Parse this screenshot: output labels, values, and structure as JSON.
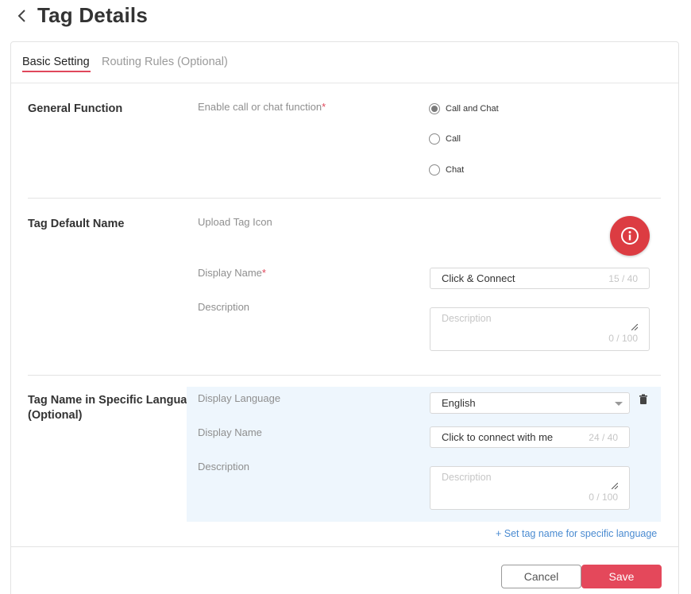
{
  "header": {
    "title": "Tag Details"
  },
  "tabs": [
    {
      "label": "Basic Setting",
      "active": true
    },
    {
      "label": "Routing Rules (Optional)",
      "active": false
    }
  ],
  "general": {
    "title": "General Function",
    "field_label": "Enable call or chat function",
    "required_mark": "*",
    "options": [
      {
        "label": "Call and Chat",
        "checked": true
      },
      {
        "label": "Call",
        "checked": false
      },
      {
        "label": "Chat",
        "checked": false
      }
    ]
  },
  "default_name": {
    "title": "Tag Default Name",
    "upload_label": "Upload Tag Icon",
    "icon_name": "info-icon",
    "display_name_label": "Display Name",
    "required_mark": "*",
    "display_name_value": "Click & Connect",
    "display_name_count": "15 / 40",
    "description_label": "Description",
    "description_placeholder": "Description",
    "description_count": "0 / 100"
  },
  "specific_language": {
    "title_line1": "Tag Name in Specific Language",
    "title_line2": "(Optional)",
    "language_label": "Display Language",
    "language_value": "English",
    "display_name_label": "Display Name",
    "display_name_value": "Click to connect with me",
    "display_name_count": "24 / 40",
    "description_label": "Description",
    "description_placeholder": "Description",
    "description_count": "0 / 100",
    "add_link": "+ Set tag name for specific language"
  },
  "footer": {
    "cancel_label": "Cancel",
    "save_label": "Save"
  },
  "colors": {
    "accent": "#e4485b",
    "link": "#4a8bd1",
    "icon_bg": "#dc3c42",
    "lang_block_bg": "#eef6fd"
  }
}
